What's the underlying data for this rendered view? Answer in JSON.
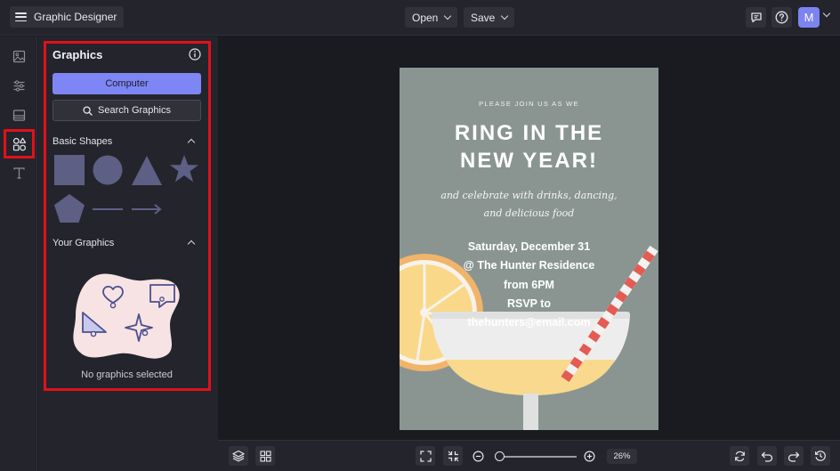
{
  "app": {
    "title": "Graphic Designer"
  },
  "toolbar": {
    "open_label": "Open",
    "save_label": "Save",
    "avatar_initial": "M"
  },
  "rail": {
    "items": [
      "image-icon",
      "sliders-icon",
      "layout-icon",
      "shapes-icon",
      "text-icon"
    ],
    "active_item": "shapes-icon"
  },
  "panel": {
    "title": "Graphics",
    "computer_button": "Computer",
    "search_button": "Search Graphics",
    "basic_shapes_label": "Basic Shapes",
    "shapes": [
      "square",
      "circle",
      "triangle",
      "star",
      "pentagon",
      "line",
      "arrow"
    ],
    "your_graphics_label": "Your Graphics",
    "empty_text": "No graphics selected"
  },
  "poster": {
    "intro": "PLEASE JOIN US AS WE",
    "title_line1": "RING IN THE",
    "title_line2": "NEW YEAR!",
    "script_line1": "and celebrate with drinks, dancing,",
    "script_line2": "and delicious food",
    "details": [
      "Saturday, December 31",
      "@ The Hunter Residence",
      "from 6PM",
      "RSVP to",
      "thehunters@email.com"
    ]
  },
  "bottom": {
    "zoom_label": "26%",
    "zoom_level": 0.26
  },
  "colors": {
    "accent": "#7d86f4",
    "highlight": "#e2101a",
    "poster_bg": "#8a9591"
  }
}
